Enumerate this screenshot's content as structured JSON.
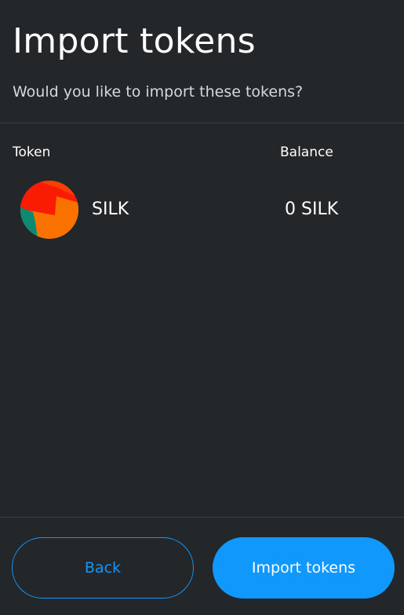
{
  "header": {
    "title": "Import tokens",
    "subtitle": "Would you like to import these tokens?"
  },
  "table": {
    "columns": {
      "token": "Token",
      "balance": "Balance"
    },
    "rows": [
      {
        "symbol": "SILK",
        "balance": "0 SILK",
        "avatar_icon": "token-identicon",
        "avatar_colors": [
          "#f97200",
          "#fa1b03",
          "#0e8a73",
          "#f73f01"
        ]
      }
    ]
  },
  "footer": {
    "back_label": "Back",
    "import_label": "Import tokens"
  },
  "colors": {
    "background": "#24272a",
    "accent": "#1098fc",
    "divider": "#3b4046"
  }
}
